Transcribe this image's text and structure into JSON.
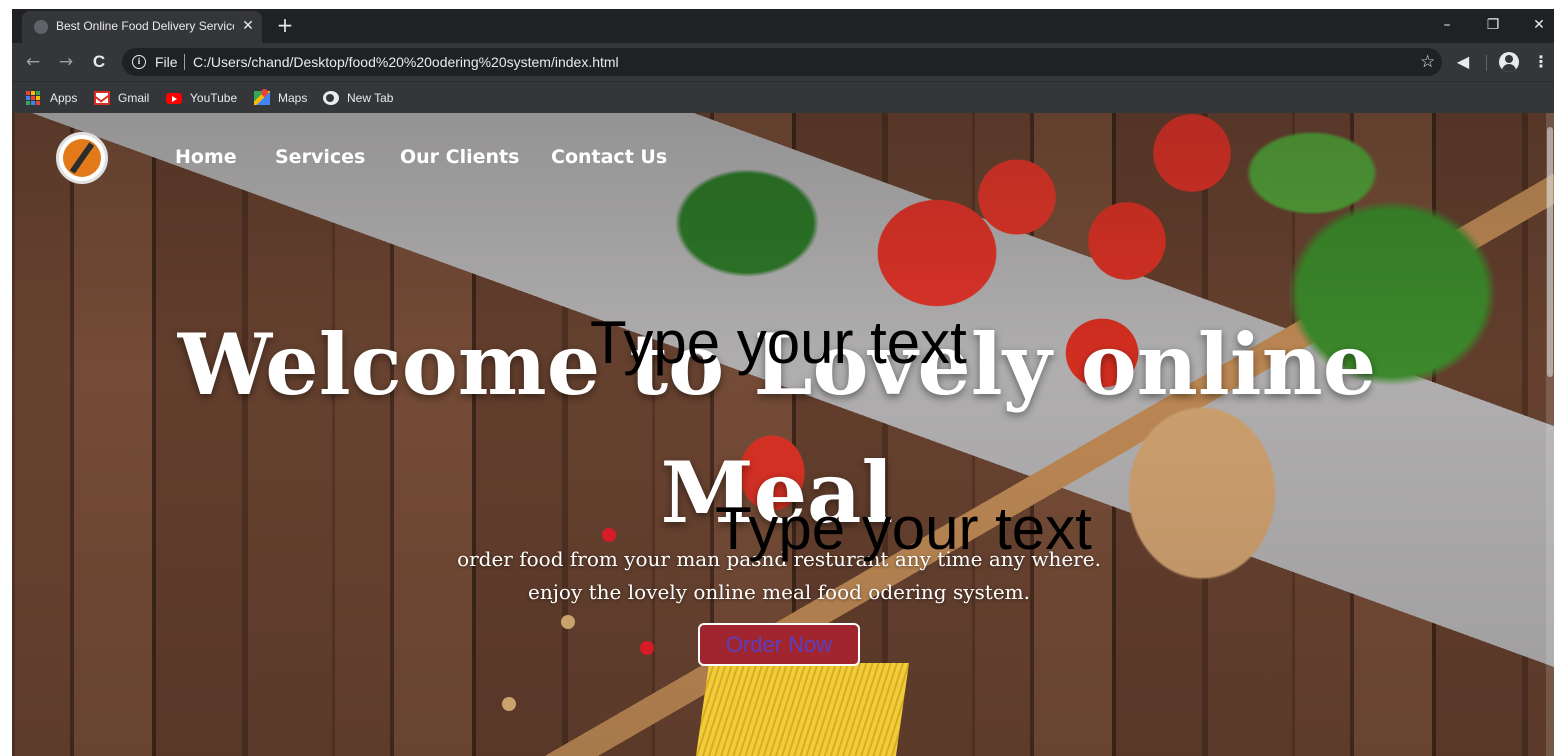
{
  "browser": {
    "tab_title": "Best Online Food Delivery Service",
    "tab_close": "✕",
    "new_tab": "+",
    "window_controls": {
      "minimize": "–",
      "restore": "❐",
      "close": "✕"
    },
    "nav": {
      "back": "←",
      "forward": "→",
      "reload": "C"
    },
    "scheme_label": "File",
    "url": "C:/Users/chand/Desktop/food%20%20odering%20system/index.html",
    "bookmarks": [
      {
        "label": "Apps",
        "icon": "apps-grid-icon"
      },
      {
        "label": "Gmail",
        "icon": "gmail-icon"
      },
      {
        "label": "YouTube",
        "icon": "youtube-icon"
      },
      {
        "label": "Maps",
        "icon": "maps-icon"
      },
      {
        "label": "New Tab",
        "icon": "globe-icon"
      }
    ]
  },
  "site": {
    "nav_links": [
      "Home",
      "Services",
      "Our Clients",
      "Contact Us"
    ],
    "hero_title_line1": "Welcome to Lovely online",
    "hero_title_line2": "Meal",
    "hero_subtitle_line1": "order food from your man pasnd resturant any time any where.",
    "hero_subtitle_line2": "enjoy the lovely online meal food odering system.",
    "order_button": "Order Now",
    "overlay_text_1": "Type your text",
    "overlay_text_2": "Type your text"
  },
  "colors": {
    "chrome_dark": "#202124",
    "chrome_toolbar": "#35363a",
    "order_button_bg": "#a1252e",
    "order_button_text": "#5a3fc0"
  }
}
